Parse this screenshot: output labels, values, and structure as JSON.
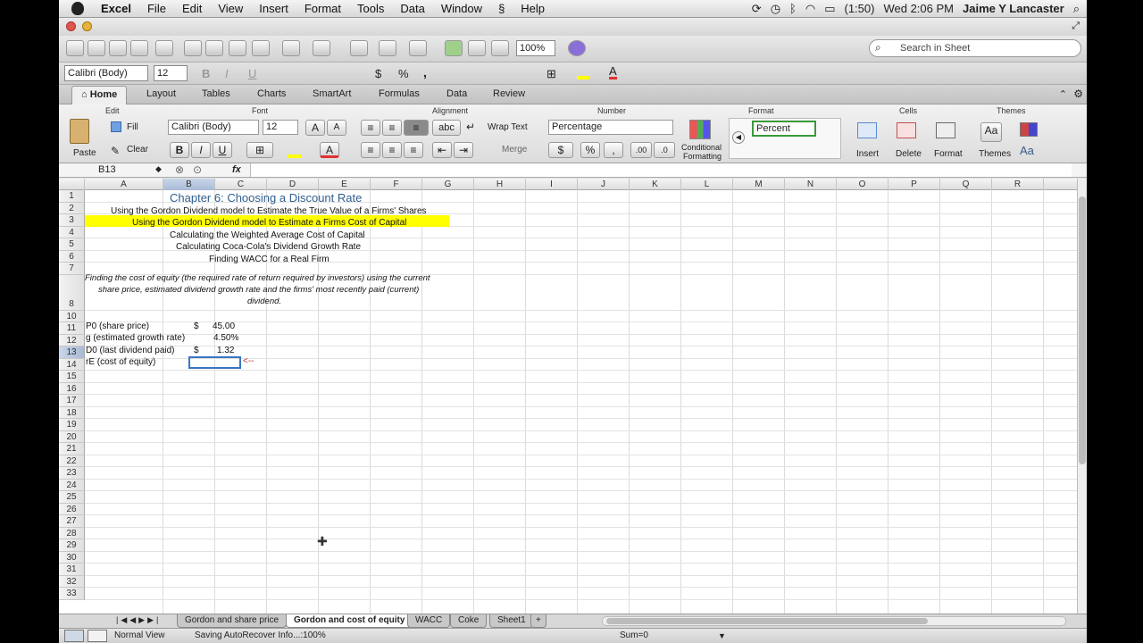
{
  "menubar": {
    "app": "Excel",
    "items": [
      "File",
      "Edit",
      "View",
      "Insert",
      "Format",
      "Tools",
      "Data",
      "Window",
      "Help"
    ],
    "battery": "(1:50)",
    "clock": "Wed 2:06 PM",
    "user": "Jaime Y Lancaster"
  },
  "toolbar": {
    "zoom": "100%",
    "search_placeholder": "Search in Sheet",
    "font": "Calibri (Body)",
    "size": "12"
  },
  "ribbon_tabs": [
    "Home",
    "Layout",
    "Tables",
    "Charts",
    "SmartArt",
    "Formulas",
    "Data",
    "Review"
  ],
  "ribbon": {
    "groups": {
      "edit": "Edit",
      "font": "Font",
      "alignment": "Alignment",
      "number": "Number",
      "format": "Format",
      "cells": "Cells",
      "themes": "Themes"
    },
    "paste": "Paste",
    "fill": "Fill",
    "clear": "Clear",
    "font": "Calibri (Body)",
    "size": "12",
    "wrap": "Wrap Text",
    "merge": "Merge",
    "abc": "abc",
    "number_format": "Percentage",
    "percent_sign": "%",
    "comma": ",",
    "dec_inc": ".00",
    "dec_dec": ".0",
    "cond": "Conditional",
    "cond2": "Formatting",
    "style_name": "Percent",
    "insert": "Insert",
    "delete": "Delete",
    "format": "Format",
    "themes": "Themes",
    "aa": "Aa",
    "bold": "B",
    "italic": "I",
    "underline": "U",
    "a_up": "A",
    "a_down": "A",
    "font_color": "A"
  },
  "formula_bar": {
    "cell_ref": "B13",
    "fx": "fx",
    "content": ""
  },
  "columns": [
    "A",
    "B",
    "C",
    "D",
    "E",
    "F",
    "G",
    "H",
    "I",
    "J",
    "K",
    "L",
    "M",
    "N",
    "O",
    "P",
    "Q",
    "R"
  ],
  "rows": [
    "1",
    "2",
    "3",
    "4",
    "5",
    "6",
    "7",
    "8",
    "10",
    "11",
    "12",
    "13",
    "14",
    "15",
    "16",
    "17",
    "18",
    "19",
    "20",
    "21",
    "22",
    "23",
    "24",
    "25",
    "26",
    "27",
    "28",
    "29",
    "30",
    "31",
    "32",
    "33"
  ],
  "cells": {
    "title": "Chapter 6: Choosing a Discount Rate",
    "r2": "Using the Gordon Dividend model to Estimate the True Value of a Firms' Shares",
    "r3": "Using the Gordon Dividend model to Estimate a Firms Cost of Capital",
    "r4": "Calculating the Weighted Average Cost of Capital",
    "r5": "Calculating Coca-Cola's Dividend Growth Rate",
    "r6": "Finding WACC for a Real Firm",
    "r8a": "Finding the cost of equity (the required rate of return required by investors) using the current",
    "r8b": "share price, estimated dividend growth rate and the firms' most recently paid (current)",
    "r8c": "dividend.",
    "a10": "P0 (share price)",
    "b10s": "$",
    "b10": "45.00",
    "a11": "g (estimated growth rate)",
    "b11": "4.50%",
    "a12": "D0 (last dividend paid)",
    "b12s": "$",
    "b12": "1.32",
    "a13": "rE (cost of equity)",
    "arrow": "<--"
  },
  "sheets": [
    "Gordon and share price",
    "Gordon and cost of equity",
    "WACC",
    "Coke",
    "Sheet1",
    "+"
  ],
  "status": {
    "view": "Normal View",
    "message": "Saving AutoRecover Info...:100%",
    "sum": "Sum=0"
  },
  "colors": {
    "highlight": "#ffff00",
    "title": "#2f5f8f",
    "accent": "#3a74c4"
  }
}
